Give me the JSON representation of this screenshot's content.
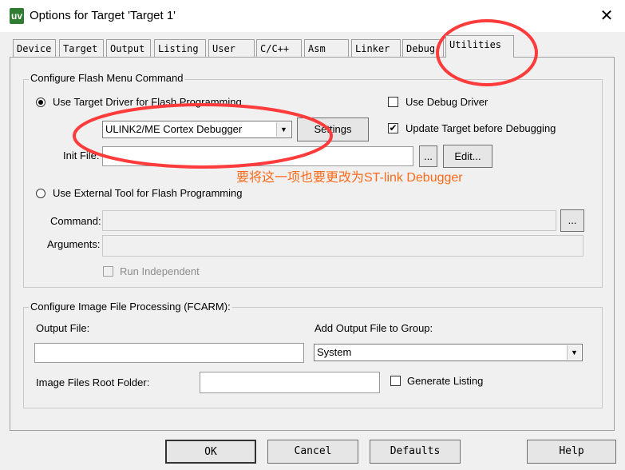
{
  "window": {
    "title": "Options for Target 'Target 1'",
    "close_glyph": "✕",
    "app_icon": "uv"
  },
  "tabs": [
    {
      "label": "Device"
    },
    {
      "label": "Target"
    },
    {
      "label": "Output"
    },
    {
      "label": "Listing"
    },
    {
      "label": "User"
    },
    {
      "label": "C/C++"
    },
    {
      "label": "Asm"
    },
    {
      "label": "Linker"
    },
    {
      "label": "Debug"
    },
    {
      "label": "Utilities"
    }
  ],
  "active_tab": "Utilities",
  "flash": {
    "group_label": "Configure Flash Menu Command",
    "use_target_driver_label": "Use Target Driver for Flash Programming",
    "driver_select_value": "ULINK2/ME Cortex Debugger",
    "settings_label": "Settings",
    "init_file_label": "Init File:",
    "init_file_value": "",
    "browse_label": "...",
    "edit_label": "Edit...",
    "use_debug_driver_label": "Use Debug Driver",
    "update_target_label": "Update Target before Debugging",
    "use_external_tool_label": "Use External Tool for Flash Programming",
    "command_label": "Command:",
    "arguments_label": "Arguments:",
    "run_independent_label": "Run Independent",
    "check_mark": "✔"
  },
  "annotation_text": "要将这一项也要更改为ST-link Debugger",
  "fcarm": {
    "group_label": "Configure Image File Processing (FCARM):",
    "output_file_label": "Output File:",
    "output_file_value": "",
    "add_output_label": "Add Output File  to Group:",
    "group_select_value": "System",
    "root_folder_label": "Image Files Root Folder:",
    "root_folder_value": "",
    "generate_listing_label": "Generate Listing"
  },
  "footer": {
    "ok_label": "OK",
    "cancel_label": "Cancel",
    "defaults_label": "Defaults",
    "help_label": "Help"
  },
  "colors": {
    "annotation": "#ff6a1a",
    "circle": "#ff3b3b",
    "dialog_bg": "#f0f0f0"
  }
}
